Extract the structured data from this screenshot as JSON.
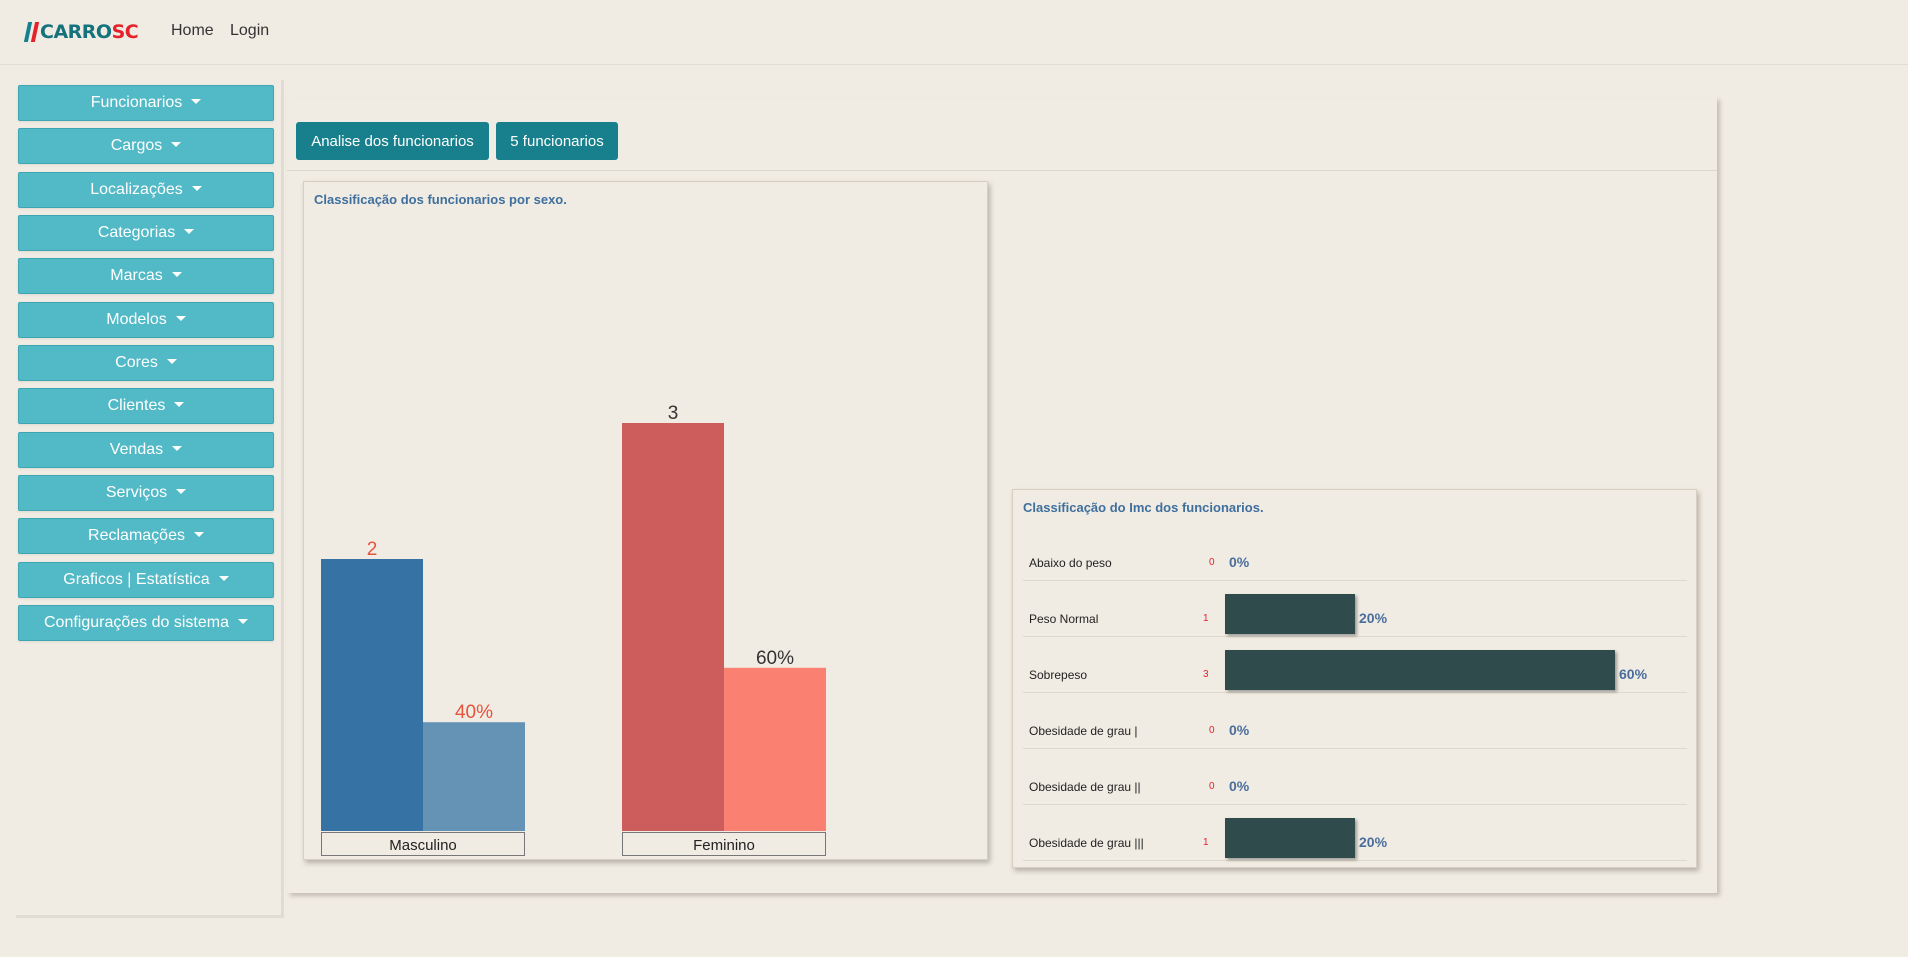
{
  "brand": {
    "part1": "CARRO",
    "part2": "SC"
  },
  "nav": {
    "home": "Home",
    "login": "Login"
  },
  "sidebar": {
    "items": [
      "Funcionarios",
      "Cargos",
      "Localizações",
      "Categorias",
      "Marcas",
      "Modelos",
      "Cores",
      "Clientes",
      "Vendas",
      "Serviços",
      "Reclamações",
      "Graficos | Estatística",
      "Configurações do sistema"
    ]
  },
  "main": {
    "analysis_button": "Analise dos funcionarios",
    "count_button": "5 funcionarios"
  },
  "sex_chart": {
    "title": "Classificação dos funcionarios por sexo."
  },
  "imc_chart": {
    "title": "Classificação do Imc dos funcionarios."
  },
  "colors": {
    "masculino_count": "#3672a4",
    "masculino_pct": "#6493b5",
    "feminino_count": "#cd5c5c",
    "feminino_pct": "#fa8072",
    "imc_bar": "#2f4b4b",
    "sidebar_button": "#52b9c6",
    "primary_button": "#17808c"
  },
  "chart_data": [
    {
      "type": "bar",
      "title": "Classificação dos funcionarios por sexo.",
      "categories": [
        "Masculino",
        "Feminino"
      ],
      "series": [
        {
          "values": [
            2,
            3
          ],
          "labels": [
            "2",
            "3"
          ]
        },
        {
          "values": [
            40,
            60
          ],
          "labels": [
            "40%",
            "60%"
          ]
        }
      ]
    },
    {
      "type": "bar",
      "title": "Classificação do Imc dos funcionarios.",
      "categories": [
        "Abaixo do peso",
        "Peso Normal",
        "Sobrepeso",
        "Obesidade de grau |",
        "Obesidade de grau ||",
        "Obesidade de grau |||"
      ],
      "counts": [
        "0",
        "1",
        "3",
        "0",
        "0",
        "1"
      ],
      "values": [
        0,
        20,
        60,
        0,
        0,
        20
      ],
      "labels": [
        "0%",
        "20%",
        "60%",
        "0%",
        "0%",
        "20%"
      ]
    }
  ]
}
